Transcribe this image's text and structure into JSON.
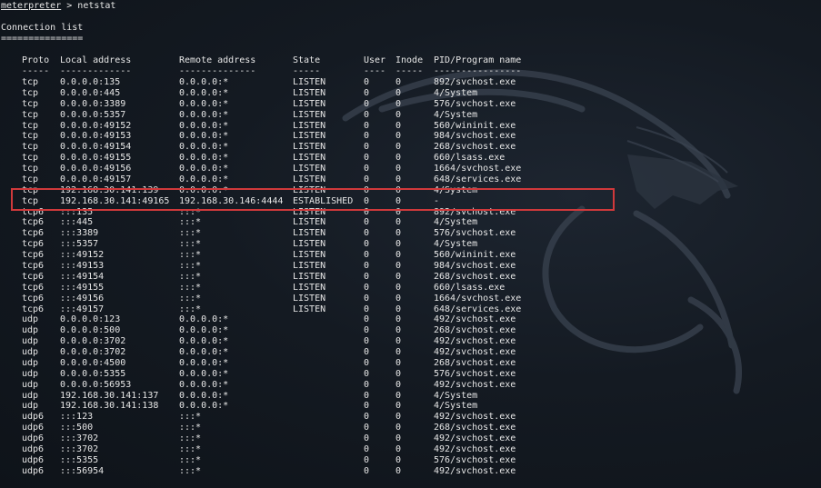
{
  "terminal": {
    "prompt": "meterpreter",
    "prompt_sep": " > ",
    "command": "netstat",
    "title": "Connection list",
    "title_underline": "===============",
    "headers": [
      "Proto",
      "Local address",
      "Remote address",
      "State",
      "User",
      "Inode",
      "PID/Program name"
    ],
    "header_dashes": [
      "-----",
      "-------------",
      "--------------",
      "-----",
      "----",
      "-----",
      "----------------"
    ],
    "rows": [
      [
        "tcp",
        "0.0.0.0:135",
        "0.0.0.0:*",
        "LISTEN",
        "0",
        "0",
        "892/svchost.exe"
      ],
      [
        "tcp",
        "0.0.0.0:445",
        "0.0.0.0:*",
        "LISTEN",
        "0",
        "0",
        "4/System"
      ],
      [
        "tcp",
        "0.0.0.0:3389",
        "0.0.0.0:*",
        "LISTEN",
        "0",
        "0",
        "576/svchost.exe"
      ],
      [
        "tcp",
        "0.0.0.0:5357",
        "0.0.0.0:*",
        "LISTEN",
        "0",
        "0",
        "4/System"
      ],
      [
        "tcp",
        "0.0.0.0:49152",
        "0.0.0.0:*",
        "LISTEN",
        "0",
        "0",
        "560/wininit.exe"
      ],
      [
        "tcp",
        "0.0.0.0:49153",
        "0.0.0.0:*",
        "LISTEN",
        "0",
        "0",
        "984/svchost.exe"
      ],
      [
        "tcp",
        "0.0.0.0:49154",
        "0.0.0.0:*",
        "LISTEN",
        "0",
        "0",
        "268/svchost.exe"
      ],
      [
        "tcp",
        "0.0.0.0:49155",
        "0.0.0.0:*",
        "LISTEN",
        "0",
        "0",
        "660/lsass.exe"
      ],
      [
        "tcp",
        "0.0.0.0:49156",
        "0.0.0.0:*",
        "LISTEN",
        "0",
        "0",
        "1664/svchost.exe"
      ],
      [
        "tcp",
        "0.0.0.0:49157",
        "0.0.0.0:*",
        "LISTEN",
        "0",
        "0",
        "648/services.exe"
      ],
      [
        "tcp",
        "192.168.30.141:139",
        "0.0.0.0:*",
        "LISTEN",
        "0",
        "0",
        "4/System"
      ],
      [
        "tcp",
        "192.168.30.141:49165",
        "192.168.30.146:4444",
        "ESTABLISHED",
        "0",
        "0",
        "-"
      ],
      [
        "tcp6",
        ":::135",
        ":::*",
        "LISTEN",
        "0",
        "0",
        "892/svchost.exe"
      ],
      [
        "tcp6",
        ":::445",
        ":::*",
        "LISTEN",
        "0",
        "0",
        "4/System"
      ],
      [
        "tcp6",
        ":::3389",
        ":::*",
        "LISTEN",
        "0",
        "0",
        "576/svchost.exe"
      ],
      [
        "tcp6",
        ":::5357",
        ":::*",
        "LISTEN",
        "0",
        "0",
        "4/System"
      ],
      [
        "tcp6",
        ":::49152",
        ":::*",
        "LISTEN",
        "0",
        "0",
        "560/wininit.exe"
      ],
      [
        "tcp6",
        ":::49153",
        ":::*",
        "LISTEN",
        "0",
        "0",
        "984/svchost.exe"
      ],
      [
        "tcp6",
        ":::49154",
        ":::*",
        "LISTEN",
        "0",
        "0",
        "268/svchost.exe"
      ],
      [
        "tcp6",
        ":::49155",
        ":::*",
        "LISTEN",
        "0",
        "0",
        "660/lsass.exe"
      ],
      [
        "tcp6",
        ":::49156",
        ":::*",
        "LISTEN",
        "0",
        "0",
        "1664/svchost.exe"
      ],
      [
        "tcp6",
        ":::49157",
        ":::*",
        "LISTEN",
        "0",
        "0",
        "648/services.exe"
      ],
      [
        "udp",
        "0.0.0.0:123",
        "0.0.0.0:*",
        "",
        "0",
        "0",
        "492/svchost.exe"
      ],
      [
        "udp",
        "0.0.0.0:500",
        "0.0.0.0:*",
        "",
        "0",
        "0",
        "268/svchost.exe"
      ],
      [
        "udp",
        "0.0.0.0:3702",
        "0.0.0.0:*",
        "",
        "0",
        "0",
        "492/svchost.exe"
      ],
      [
        "udp",
        "0.0.0.0:3702",
        "0.0.0.0:*",
        "",
        "0",
        "0",
        "492/svchost.exe"
      ],
      [
        "udp",
        "0.0.0.0:4500",
        "0.0.0.0:*",
        "",
        "0",
        "0",
        "268/svchost.exe"
      ],
      [
        "udp",
        "0.0.0.0:5355",
        "0.0.0.0:*",
        "",
        "0",
        "0",
        "576/svchost.exe"
      ],
      [
        "udp",
        "0.0.0.0:56953",
        "0.0.0.0:*",
        "",
        "0",
        "0",
        "492/svchost.exe"
      ],
      [
        "udp",
        "192.168.30.141:137",
        "0.0.0.0:*",
        "",
        "0",
        "0",
        "4/System"
      ],
      [
        "udp",
        "192.168.30.141:138",
        "0.0.0.0:*",
        "",
        "0",
        "0",
        "4/System"
      ],
      [
        "udp6",
        ":::123",
        ":::*",
        "",
        "0",
        "0",
        "492/svchost.exe"
      ],
      [
        "udp6",
        ":::500",
        ":::*",
        "",
        "0",
        "0",
        "268/svchost.exe"
      ],
      [
        "udp6",
        ":::3702",
        ":::*",
        "",
        "0",
        "0",
        "492/svchost.exe"
      ],
      [
        "udp6",
        ":::3702",
        ":::*",
        "",
        "0",
        "0",
        "492/svchost.exe"
      ],
      [
        "udp6",
        ":::5355",
        ":::*",
        "",
        "0",
        "0",
        "576/svchost.exe"
      ],
      [
        "udp6",
        ":::56954",
        ":::*",
        "",
        "0",
        "0",
        "492/svchost.exe"
      ]
    ],
    "highlighted_row_index": 11
  },
  "colors": {
    "background": "#141a22",
    "text": "#e6e6e6",
    "highlight_border": "#d0393b"
  },
  "background_art": {
    "icon": "kali-dragon-icon"
  }
}
